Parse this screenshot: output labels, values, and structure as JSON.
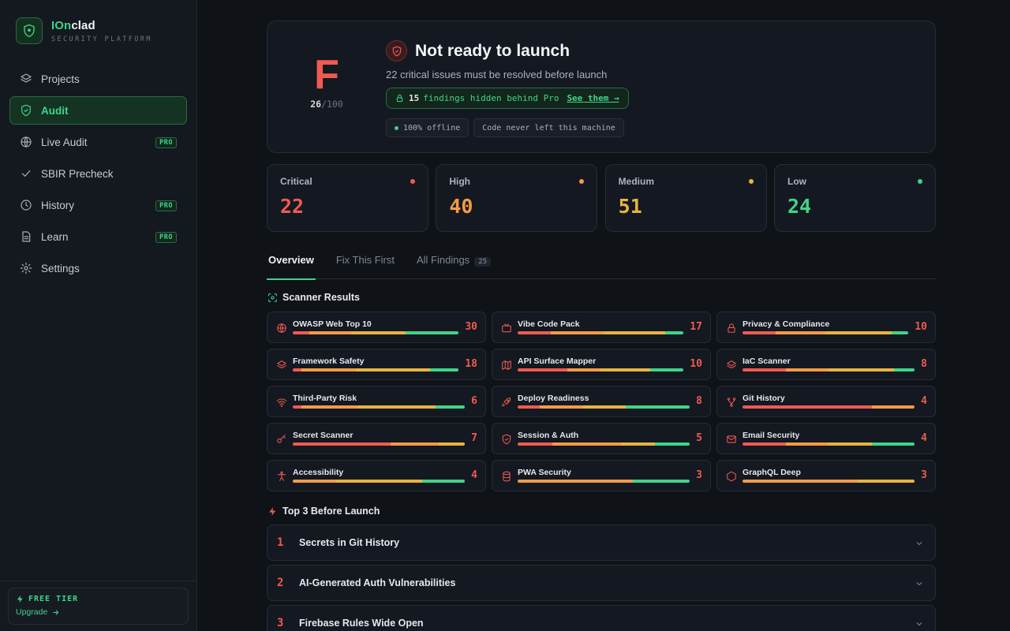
{
  "brand": {
    "name_accent": "IOn",
    "name_rest": "clad",
    "subtitle": "SECURITY PLATFORM"
  },
  "sidebar": {
    "items": [
      {
        "label": "Projects",
        "icon": "layers-icon",
        "pro": false,
        "active": false
      },
      {
        "label": "Audit",
        "icon": "shield-icon",
        "pro": false,
        "active": true
      },
      {
        "label": "Live Audit",
        "icon": "globe-icon",
        "pro": true,
        "active": false
      },
      {
        "label": "SBIR Precheck",
        "icon": "check-icon",
        "pro": false,
        "active": false
      },
      {
        "label": "History",
        "icon": "clock-icon",
        "pro": true,
        "active": false
      },
      {
        "label": "Learn",
        "icon": "document-icon",
        "pro": true,
        "active": false
      },
      {
        "label": "Settings",
        "icon": "gear-icon",
        "pro": false,
        "active": false
      }
    ],
    "pro_badge": "PRO",
    "tier": {
      "title": "FREE TIER",
      "upgrade": "Upgrade"
    }
  },
  "hero": {
    "grade": "F",
    "score": "26",
    "score_max": "/100",
    "title": "Not ready to launch",
    "subtitle": "22 critical issues must be resolved before launch",
    "hidden_count": "15",
    "hidden_text": "findings hidden behind Pro",
    "hidden_link": "See them →",
    "tags": [
      "100% offline",
      "Code never left this machine"
    ]
  },
  "severity": [
    {
      "label": "Critical",
      "value": "22",
      "color": "#f05a52"
    },
    {
      "label": "High",
      "value": "40",
      "color": "#f59a45"
    },
    {
      "label": "Medium",
      "value": "51",
      "color": "#e8b43e"
    },
    {
      "label": "Low",
      "value": "24",
      "color": "#3fd48a"
    }
  ],
  "tabs": [
    {
      "label": "Overview",
      "active": true,
      "count": ""
    },
    {
      "label": "Fix This First",
      "active": false,
      "count": ""
    },
    {
      "label": "All Findings",
      "active": false,
      "count": "25"
    }
  ],
  "scanner_results": {
    "title": "Scanner Results",
    "items": [
      {
        "name": "OWASP Web Top 10",
        "count": "30",
        "icon": "globe-icon",
        "segments": [
          0.1,
          0.25,
          0.33,
          0.32
        ]
      },
      {
        "name": "Vibe Code Pack",
        "count": "17",
        "icon": "tv-icon",
        "segments": [
          0.2,
          0.32,
          0.37,
          0.11
        ]
      },
      {
        "name": "Privacy & Compliance",
        "count": "10",
        "icon": "lock-icon",
        "segments": [
          0.2,
          0.3,
          0.4,
          0.1
        ]
      },
      {
        "name": "Framework Safety",
        "count": "18",
        "icon": "layers-icon",
        "segments": [
          0.05,
          0.33,
          0.45,
          0.17
        ]
      },
      {
        "name": "API Surface Mapper",
        "count": "10",
        "icon": "map-icon",
        "segments": [
          0.3,
          0.2,
          0.3,
          0.2
        ]
      },
      {
        "name": "IaC Scanner",
        "count": "8",
        "icon": "layers-icon",
        "segments": [
          0.25,
          0.25,
          0.38,
          0.12
        ]
      },
      {
        "name": "Third-Party Risk",
        "count": "6",
        "icon": "wifi-icon",
        "segments": [
          0.05,
          0.33,
          0.45,
          0.17
        ]
      },
      {
        "name": "Deploy Readiness",
        "count": "8",
        "icon": "rocket-icon",
        "segments": [
          0.13,
          0.25,
          0.25,
          0.37
        ]
      },
      {
        "name": "Git History",
        "count": "4",
        "icon": "git-branch-icon",
        "segments": [
          0.75,
          0.25,
          0,
          0
        ]
      },
      {
        "name": "Secret Scanner",
        "count": "7",
        "icon": "key-icon",
        "segments": [
          0.57,
          0.28,
          0.15,
          0
        ]
      },
      {
        "name": "Session & Auth",
        "count": "5",
        "icon": "shield-icon",
        "segments": [
          0.2,
          0.4,
          0.2,
          0.2
        ]
      },
      {
        "name": "Email Security",
        "count": "4",
        "icon": "mail-icon",
        "segments": [
          0.25,
          0.25,
          0.25,
          0.25
        ]
      },
      {
        "name": "Accessibility",
        "count": "4",
        "icon": "person-icon",
        "segments": [
          0,
          0.25,
          0.5,
          0.25
        ]
      },
      {
        "name": "PWA Security",
        "count": "3",
        "icon": "database-icon",
        "segments": [
          0,
          0.67,
          0,
          0.33
        ]
      },
      {
        "name": "GraphQL Deep",
        "count": "3",
        "icon": "hexagon-icon",
        "segments": [
          0,
          0.67,
          0.33,
          0
        ]
      }
    ]
  },
  "top3": {
    "title": "Top 3 Before Launch",
    "items": [
      {
        "num": "1",
        "title": "Secrets in Git History"
      },
      {
        "num": "2",
        "title": "AI-Generated Auth Vulnerabilities"
      },
      {
        "num": "3",
        "title": "Firebase Rules Wide Open"
      }
    ]
  },
  "colors": {
    "accent": "#3fd48a",
    "critical": "#f05a52",
    "high": "#f59a45",
    "medium": "#e8b43e",
    "low": "#3fd48a"
  }
}
